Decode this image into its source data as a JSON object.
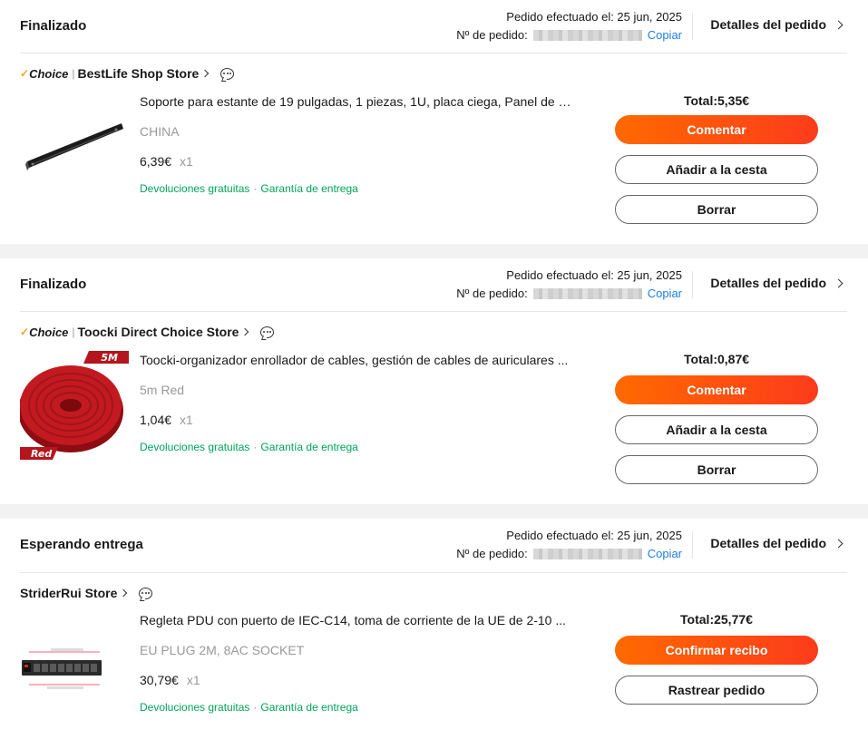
{
  "orders": [
    {
      "status": "Finalizado",
      "date_label": "Pedido efectuado el: 25 jun, 2025",
      "order_no_label": "Nº de pedido:",
      "copy_label": "Copiar",
      "details_label": "Detalles del pedido",
      "choice_label": "Choice",
      "store_name": "BestLife Shop Store",
      "product_title": "Soporte para estante de 19 pulgadas, 1 piezas, 1U, placa ciega, Panel de c...",
      "variant": "CHINA",
      "price": "6,39€",
      "qty": "x1",
      "free_returns": "Devoluciones gratuitas",
      "delivery_guarantee": "Garantía de entrega",
      "total": "Total:5,35€",
      "buttons": [
        "Comentar",
        "Añadir a la cesta",
        "Borrar"
      ]
    },
    {
      "status": "Finalizado",
      "date_label": "Pedido efectuado el: 25 jun, 2025",
      "order_no_label": "Nº de pedido:",
      "copy_label": "Copiar",
      "details_label": "Detalles del pedido",
      "choice_label": "Choice",
      "store_name": "Toocki Direct Choice Store",
      "product_title": "Toocki-organizador enrollador de cables, gestión de cables de auriculares ...",
      "variant": "5m Red",
      "price": "1,04€",
      "qty": "x1",
      "free_returns": "Devoluciones gratuitas",
      "delivery_guarantee": "Garantía de entrega",
      "total": "Total:0,87€",
      "thumb_tag_top": "5M",
      "thumb_tag_bottom": "Red",
      "buttons": [
        "Comentar",
        "Añadir a la cesta",
        "Borrar"
      ]
    },
    {
      "status": "Esperando entrega",
      "date_label": "Pedido efectuado el: 25 jun, 2025",
      "order_no_label": "Nº de pedido:",
      "copy_label": "Copiar",
      "details_label": "Detalles del pedido",
      "store_name": "StriderRui Store",
      "product_title": "Regleta PDU con puerto de IEC-C14, toma de corriente de la UE de 2-10 ...",
      "variant": "EU PLUG 2M, 8AC SOCKET",
      "price": "30,79€",
      "qty": "x1",
      "free_returns": "Devoluciones gratuitas",
      "delivery_guarantee": "Garantía de entrega",
      "total": "Total:25,77€",
      "buttons": [
        "Confirmar recibo",
        "Rastrear pedido"
      ]
    }
  ],
  "colors": {
    "accent": "#fd3b1c",
    "accent_start": "#ff6a00",
    "link": "#1f7ee0",
    "green": "#00a35b",
    "choice_tick": "#f7a51c"
  }
}
